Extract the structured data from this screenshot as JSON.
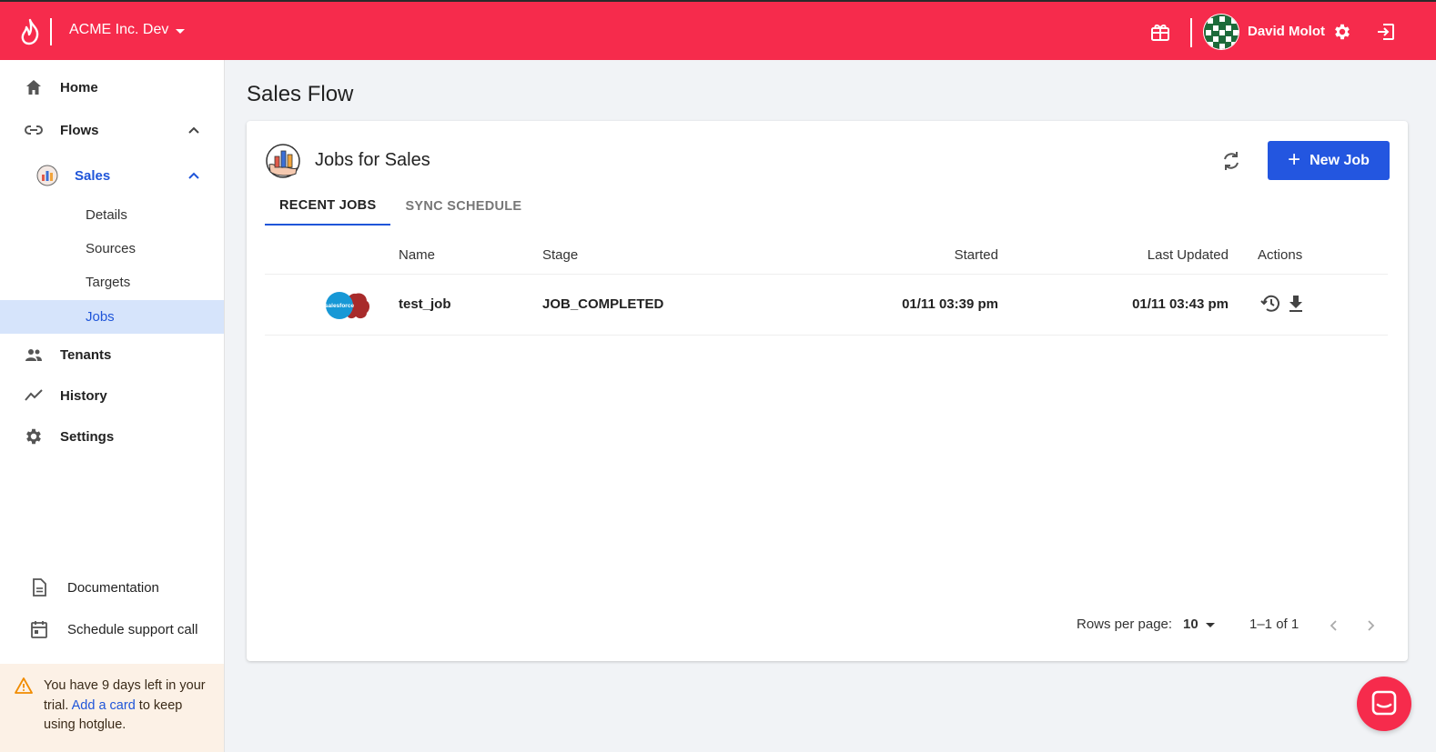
{
  "header": {
    "org_name": "ACME Inc. Dev",
    "user_name": "David Molot",
    "brand_color": "#f62b4c"
  },
  "sidebar": {
    "items": [
      {
        "label": "Home",
        "icon": "home-icon"
      },
      {
        "label": "Flows",
        "icon": "link-icon"
      },
      {
        "label": "Tenants",
        "icon": "people-icon"
      },
      {
        "label": "History",
        "icon": "trend-icon"
      },
      {
        "label": "Settings",
        "icon": "gear-icon"
      }
    ],
    "flow": {
      "label": "Sales",
      "sub_items": [
        "Details",
        "Sources",
        "Targets",
        "Jobs"
      ],
      "active_sub_item": "Jobs"
    },
    "bottom_links": [
      {
        "label": "Documentation",
        "icon": "document-icon"
      },
      {
        "label": "Schedule support call",
        "icon": "calendar-icon"
      }
    ],
    "trial": {
      "text_before": "You have 9 days left in your trial. ",
      "link": "Add a card",
      "text_after": " to keep using hotglue."
    }
  },
  "main": {
    "page_title": "Sales Flow",
    "card_title": "Jobs for Sales",
    "new_job_label": "New Job",
    "tabs": [
      {
        "label": "RECENT JOBS",
        "active": true
      },
      {
        "label": "SYNC SCHEDULE",
        "active": false
      }
    ],
    "table": {
      "columns": [
        "Name",
        "Stage",
        "Started",
        "Last Updated",
        "Actions"
      ],
      "rows": [
        {
          "source": "salesforce",
          "name": "test_job",
          "stage": "JOB_COMPLETED",
          "started": "01/11 03:39 pm",
          "last_updated": "01/11 03:43 pm"
        }
      ]
    },
    "pagination": {
      "rows_per_page_label": "Rows per page:",
      "rows_per_page": "10",
      "range": "1–1 of 1"
    }
  },
  "colors": {
    "accent": "#2356e0",
    "active_bg": "#d6e4fb"
  }
}
